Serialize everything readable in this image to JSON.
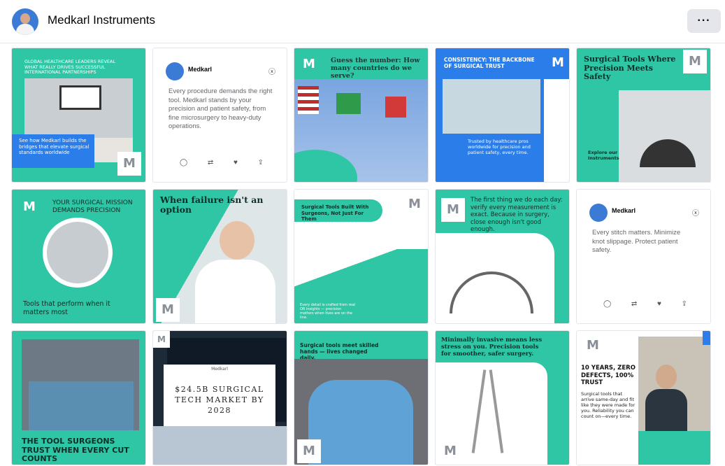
{
  "page": {
    "name": "Medkarl Instruments",
    "more_label": "···"
  },
  "logo_mark": "M",
  "tiles": {
    "t1": {
      "title": "GLOBAL HEALTHCARE LEADERS REVEAL WHAT REALLY DRIVES SUCCESSFUL INTERNATIONAL PARTNERSHIPS",
      "caption": "See how Medkarl builds the bridges that elevate surgical standards worldwide"
    },
    "t2": {
      "name": "Medkarl",
      "body": "Every procedure demands the right tool. Medkarl stands by your precision and patient safety, from fine microsurgery to heavy-duty operations."
    },
    "t3": {
      "title": "Guess the number: How many countries do we serve?"
    },
    "t4": {
      "title": "CONSISTENCY: THE BACKBONE OF SURGICAL TRUST",
      "caption": "Trusted by healthcare pros worldwide for precision and patient safety, every time."
    },
    "t5": {
      "title": "Surgical Tools Where Precision Meets Safety",
      "caption": "Explore our Instruments"
    },
    "t6": {
      "title": "YOUR SURGICAL MISSION DEMANDS PRECISION",
      "caption": "Tools that perform when it matters most"
    },
    "t7": {
      "title": "When failure isn't an option"
    },
    "t8": {
      "title": "Surgical Tools Built With Surgeons, Not Just For Them",
      "caption": "Every detail is crafted from real OR insights — precision matters when lives are on the line."
    },
    "t9": {
      "title": "The first thing we do each day: verify every measurement is exact. Because in surgery, close enough isn't good enough."
    },
    "t10": {
      "name": "Medkarl",
      "body": "Every stitch matters. Minimize knot slippage. Protect patient safety."
    },
    "t11": {
      "title": "THE TOOL SURGEONS TRUST WHEN EVERY CUT COUNTS"
    },
    "t12": {
      "brand": "Medkarl",
      "title": "$24.5B SURGICAL TECH MARKET BY 2028"
    },
    "t13": {
      "title": "Surgical tools meet skilled hands — lives changed daily."
    },
    "t14": {
      "title": "Minimally invasive means less stress on you. Precision tools for smoother, safer surgery."
    },
    "t15": {
      "title": "10 YEARS, ZERO DEFECTS, 100% TRUST",
      "caption": "Surgical tools that arrive same-day and fit like they were made for you. Reliability you can count on—every time."
    }
  },
  "icons": {
    "reply": "reply-icon",
    "retweet": "retweet-icon",
    "like": "heart-icon",
    "share": "share-icon",
    "x": "x-logo-icon"
  }
}
